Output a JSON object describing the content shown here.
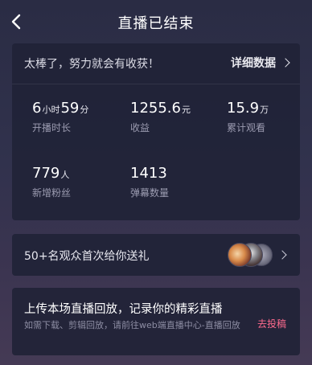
{
  "header": {
    "title": "直播已结束",
    "back_icon": "chevron-left-icon"
  },
  "summary": {
    "praise": "太棒了，努力就会有收获！",
    "detail_label": "详细数据"
  },
  "stats": [
    {
      "parts": [
        "6",
        "小时",
        "59",
        "分"
      ],
      "label": "开播时长"
    },
    {
      "parts": [
        "1255.6",
        "元"
      ],
      "label": "收益"
    },
    {
      "parts": [
        "15.9",
        "万"
      ],
      "label": "累计观看"
    },
    {
      "parts": [
        "779",
        "人"
      ],
      "label": "新增粉丝"
    },
    {
      "parts": [
        "1413"
      ],
      "label": "弹幕数量"
    }
  ],
  "gift": {
    "text": "50+名观众首次给你送礼"
  },
  "upload": {
    "title": "上传本场直播回放，记录你的精彩直播",
    "desc": "如需下载、剪辑回放，请前往web端直播中心-直播回放",
    "button": "去投稿"
  },
  "colors": {
    "accent_pink": "#ff6b8e",
    "card_bg": "#212337"
  }
}
